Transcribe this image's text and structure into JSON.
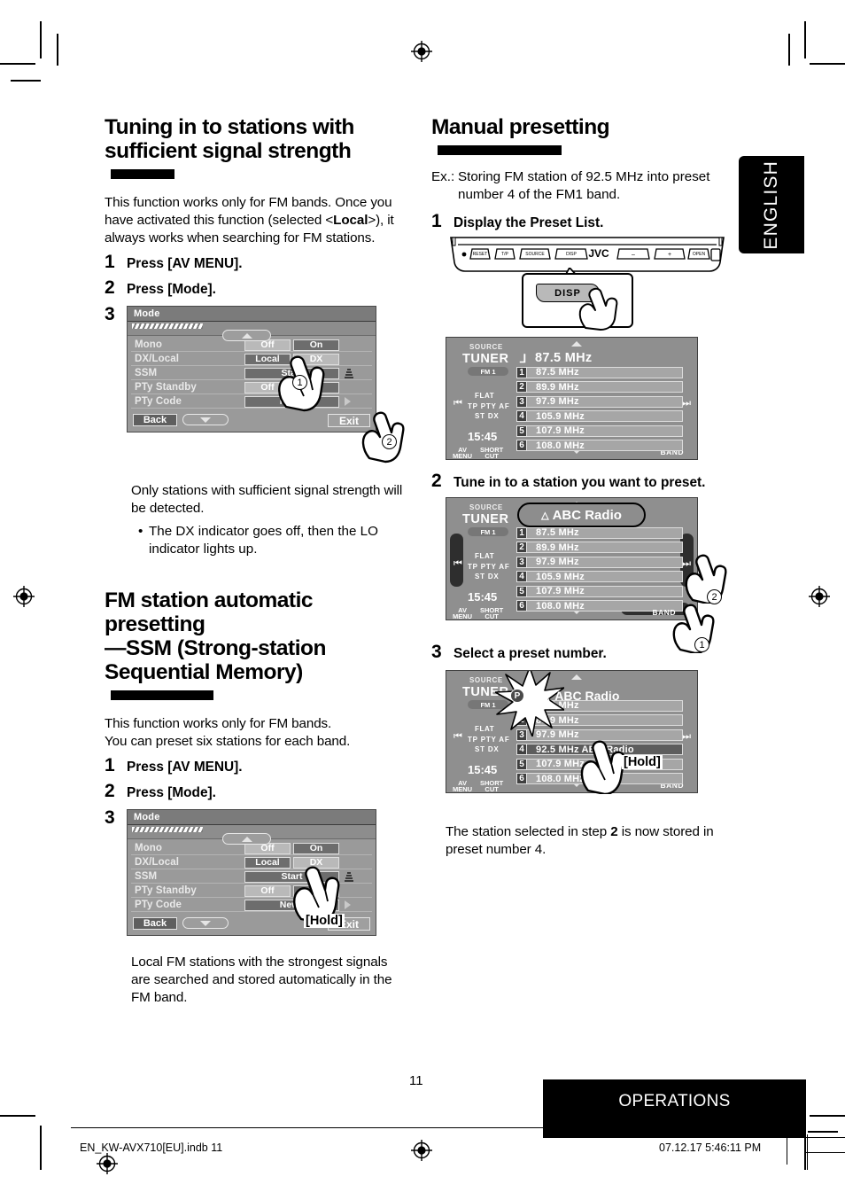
{
  "page": {
    "number": "11",
    "lang_tab": "ENGLISH",
    "footer_bar": "OPERATIONS",
    "footer_left": "EN_KW-AVX710[EU].indb   11",
    "footer_right": "07.12.17   5:46:11 PM"
  },
  "left_column": {
    "section1": {
      "heading_line1": "Tuning in to stations with",
      "heading_line2": "sufficient signal strength",
      "intro": "This function works only for FM bands. Once you have activated this function (selected <Local>), it always works when searching for FM stations.",
      "intro_part1": "This function works only for FM bands. Once you have activated this function (selected <",
      "intro_bold": "Local",
      "intro_part2": ">), it always works when searching for FM stations.",
      "steps": [
        {
          "num": "1",
          "text": "Press [AV MENU]."
        },
        {
          "num": "2",
          "text": "Press [Mode]."
        },
        {
          "num": "3",
          "text": ""
        }
      ],
      "after_text": "Only stations with sufficient signal strength will be detected.",
      "bullet": "The DX indicator goes off, then the LO indicator lights up.",
      "callouts": [
        "1",
        "2"
      ]
    },
    "section2": {
      "heading_line1": "FM station automatic presetting",
      "heading_line2": "—SSM (Strong-station",
      "heading_line3": "Sequential Memory)",
      "intro_line1": "This function works only for FM bands.",
      "intro_line2": "You can preset six stations for each band.",
      "steps": [
        {
          "num": "1",
          "text": "Press [AV MENU]."
        },
        {
          "num": "2",
          "text": "Press [Mode]."
        },
        {
          "num": "3",
          "text": ""
        }
      ],
      "hold_badge": "[Hold]",
      "after_text": "Local FM stations with the strongest signals are searched and stored automatically in the FM band."
    }
  },
  "mode_screen_1": {
    "title": "Mode",
    "rows": [
      {
        "label": "Mono",
        "buttons": [
          {
            "text": "Off",
            "style": "light"
          },
          {
            "text": "On",
            "style": "dark"
          }
        ],
        "tail": ""
      },
      {
        "label": "DX/Local",
        "buttons": [
          {
            "text": "Local",
            "style": "dark"
          },
          {
            "text": "DX",
            "style": "light"
          }
        ],
        "tail": ""
      },
      {
        "label": "SSM",
        "buttons": [
          {
            "text": "Start",
            "style": "dark",
            "wide": true
          }
        ],
        "tail": "speaker-icon"
      },
      {
        "label": "PTy Standby",
        "buttons": [
          {
            "text": "Off",
            "style": "light"
          },
          {
            "text": "On",
            "style": "dark"
          }
        ],
        "tail": ""
      },
      {
        "label": "PTy Code",
        "buttons": [
          {
            "text": "News",
            "style": "dark",
            "wide": true
          }
        ],
        "tail": "arrow-right"
      }
    ],
    "back": "Back",
    "exit": "Exit"
  },
  "mode_screen_2": {
    "title": "Mode",
    "rows": [
      {
        "label": "Mono",
        "buttons": [
          {
            "text": "Off",
            "style": "light"
          },
          {
            "text": "On",
            "style": "dark"
          }
        ],
        "tail": ""
      },
      {
        "label": "DX/Local",
        "buttons": [
          {
            "text": "Local",
            "style": "dark"
          },
          {
            "text": "DX",
            "style": "light"
          }
        ],
        "tail": ""
      },
      {
        "label": "SSM",
        "buttons": [
          {
            "text": "Start",
            "style": "dark",
            "wide": true
          }
        ],
        "tail": "speaker-icon"
      },
      {
        "label": "PTy Standby",
        "buttons": [
          {
            "text": "Off",
            "style": "light"
          },
          {
            "text": "On",
            "style": "dark"
          }
        ],
        "tail": ""
      },
      {
        "label": "PTy Code",
        "buttons": [
          {
            "text": "News",
            "style": "dark",
            "wide": true
          }
        ],
        "tail": "arrow-right"
      }
    ],
    "back": "Back",
    "exit": "Exit"
  },
  "right_column": {
    "heading": "Manual presetting",
    "example_label": "Ex.:",
    "example_text": "Storing FM station of 92.5 MHz into preset number 4 of the FM1 band.",
    "steps": [
      {
        "num": "1",
        "text": "Display the Preset List."
      },
      {
        "num": "2",
        "text": "Tune in to a station you want to preset."
      },
      {
        "num": "3",
        "text": "Select a preset number."
      }
    ],
    "result_text_part1": "The station selected in step ",
    "result_step_bold": "2",
    "result_text_part2": " is now stored in preset number 4.",
    "hold_badge": "[Hold]",
    "callouts": [
      "1",
      "2"
    ]
  },
  "faceplate": {
    "brand": "JVC",
    "popup_key": "DISP"
  },
  "tuner_screen_1": {
    "source_label": "SOURCE",
    "source": "TUNER",
    "band": "FM 1",
    "eq": "FLAT",
    "ind_row1": "TP PTY AF",
    "ind_row2": "ST  DX",
    "clock": "15:45",
    "av_menu": "AV\nMENU",
    "av_menu_l1": "AV",
    "av_menu_l2": "MENU",
    "shortcut_l1": "SHORT",
    "shortcut_l2": "CUT",
    "band_button": "BAND",
    "now_playing": "87.5 MHz",
    "presets": [
      {
        "num": "1",
        "value": "87.5 MHz",
        "selected": false
      },
      {
        "num": "2",
        "value": "89.9 MHz",
        "selected": false
      },
      {
        "num": "3",
        "value": "97.9 MHz",
        "selected": false
      },
      {
        "num": "4",
        "value": "105.9 MHz",
        "selected": false
      },
      {
        "num": "5",
        "value": "107.9 MHz",
        "selected": false
      },
      {
        "num": "6",
        "value": "108.0 MHz",
        "selected": false
      }
    ]
  },
  "tuner_screen_2": {
    "source_label": "SOURCE",
    "source": "TUNER",
    "band": "FM 1",
    "eq": "FLAT",
    "ind_row1": "TP PTY AF",
    "ind_row2": "ST  DX",
    "clock": "15:45",
    "av_menu_l1": "AV",
    "av_menu_l2": "MENU",
    "shortcut_l1": "SHORT",
    "shortcut_l2": "CUT",
    "band_button": "BAND",
    "now_playing": "ABC Radio",
    "presets": [
      {
        "num": "1",
        "value": "87.5 MHz",
        "selected": false
      },
      {
        "num": "2",
        "value": "89.9 MHz",
        "selected": false
      },
      {
        "num": "3",
        "value": "97.9 MHz",
        "selected": false
      },
      {
        "num": "4",
        "value": "105.9 MHz",
        "selected": false
      },
      {
        "num": "5",
        "value": "107.9 MHz",
        "selected": false
      },
      {
        "num": "6",
        "value": "108.0 MHz",
        "selected": false
      }
    ]
  },
  "tuner_screen_3": {
    "source_label": "SOURCE",
    "source": "TUNER",
    "band": "FM 1",
    "eq": "FLAT",
    "ind_row1": "TP PTY AF",
    "ind_row2": "ST  DX",
    "clock": "15:45",
    "av_menu_l1": "AV",
    "av_menu_l2": "MENU",
    "shortcut_l1": "SHORT",
    "shortcut_l2": "CUT",
    "band_button": "BAND",
    "preset_chip": "4",
    "preset_chip_prefix": "P",
    "now_playing": "ABC Radio",
    "presets": [
      {
        "num": "1",
        "value": "87.5 MHz",
        "selected": false
      },
      {
        "num": "2",
        "value": "89.9 MHz",
        "selected": false
      },
      {
        "num": "3",
        "value": "97.9 MHz",
        "selected": false
      },
      {
        "num": "4",
        "value": "92.5 MHz  ABC Radio",
        "selected": true
      },
      {
        "num": "5",
        "value": "107.9 MHz",
        "selected": false
      },
      {
        "num": "6",
        "value": "108.0 MHz",
        "selected": false
      }
    ]
  },
  "colors": {
    "screen_bg": "#8f8f8f",
    "mode_bg": "#9a9a9a",
    "accent_black": "#000000",
    "preset_row": "#a6a6a6",
    "preset_selected": "#5d5d5d"
  }
}
